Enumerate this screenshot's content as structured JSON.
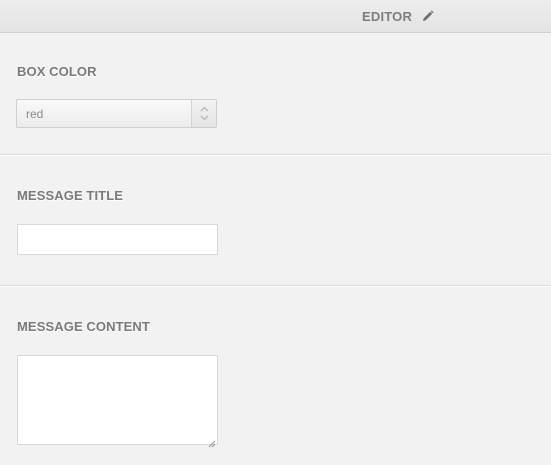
{
  "header": {
    "tab_label": "EDITOR",
    "tab_icon": "pencil-icon"
  },
  "fields": {
    "box_color": {
      "label": "BOX COLOR",
      "value": "red"
    },
    "message_title": {
      "label": "MESSAGE TITLE",
      "value": ""
    },
    "message_content": {
      "label": "MESSAGE CONTENT",
      "value": ""
    }
  },
  "colors": {
    "background": "#f2f2f2",
    "label": "#7a7a7a",
    "header_text": "#7d7d7d"
  }
}
